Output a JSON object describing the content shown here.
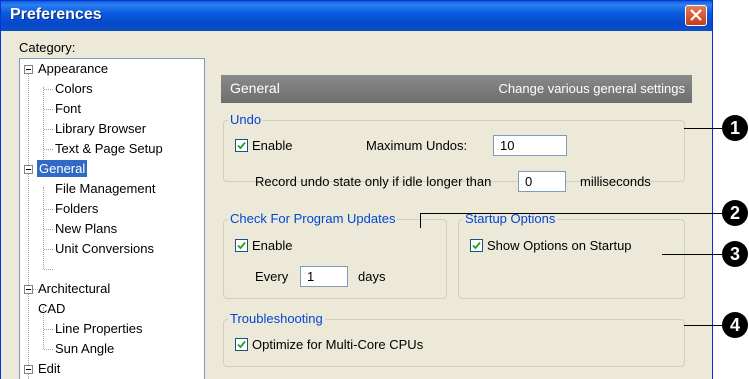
{
  "window": {
    "title": "Preferences"
  },
  "category_label": "Category:",
  "tree": [
    {
      "label": "Appearance"
    },
    {
      "label": "Colors"
    },
    {
      "label": "Font"
    },
    {
      "label": "Library Browser"
    },
    {
      "label": "Text & Page Setup"
    },
    {
      "label": "General"
    },
    {
      "label": "File Management"
    },
    {
      "label": "Folders"
    },
    {
      "label": "New Plans"
    },
    {
      "label": "Unit Conversions"
    },
    {
      "label": "Architectural"
    },
    {
      "label": "CAD"
    },
    {
      "label": "Line Properties"
    },
    {
      "label": "Sun Angle"
    },
    {
      "label": "Edit"
    }
  ],
  "header": {
    "title": "General",
    "description": "Change various general settings"
  },
  "undo": {
    "title": "Undo",
    "enable_label": "Enable",
    "max_label": "Maximum Undos:",
    "max_value": "10",
    "idle_label": "Record undo state only if idle longer than",
    "idle_value": "0",
    "idle_unit": "milliseconds"
  },
  "updates": {
    "title": "Check For Program Updates",
    "enable_label": "Enable",
    "every_label": "Every",
    "every_value": "1",
    "days_label": "days"
  },
  "startup": {
    "title": "Startup Options",
    "show_label": "Show Options on Startup"
  },
  "trouble": {
    "title": "Troubleshooting",
    "optimize_label": "Optimize for Multi-Core CPUs"
  },
  "callouts": [
    "1",
    "2",
    "3",
    "4"
  ],
  "colors": {
    "title_bar": "#0548c9",
    "selection": "#316ac5",
    "group_title": "#0046d5",
    "dialog_bg": "#ece9d8"
  }
}
